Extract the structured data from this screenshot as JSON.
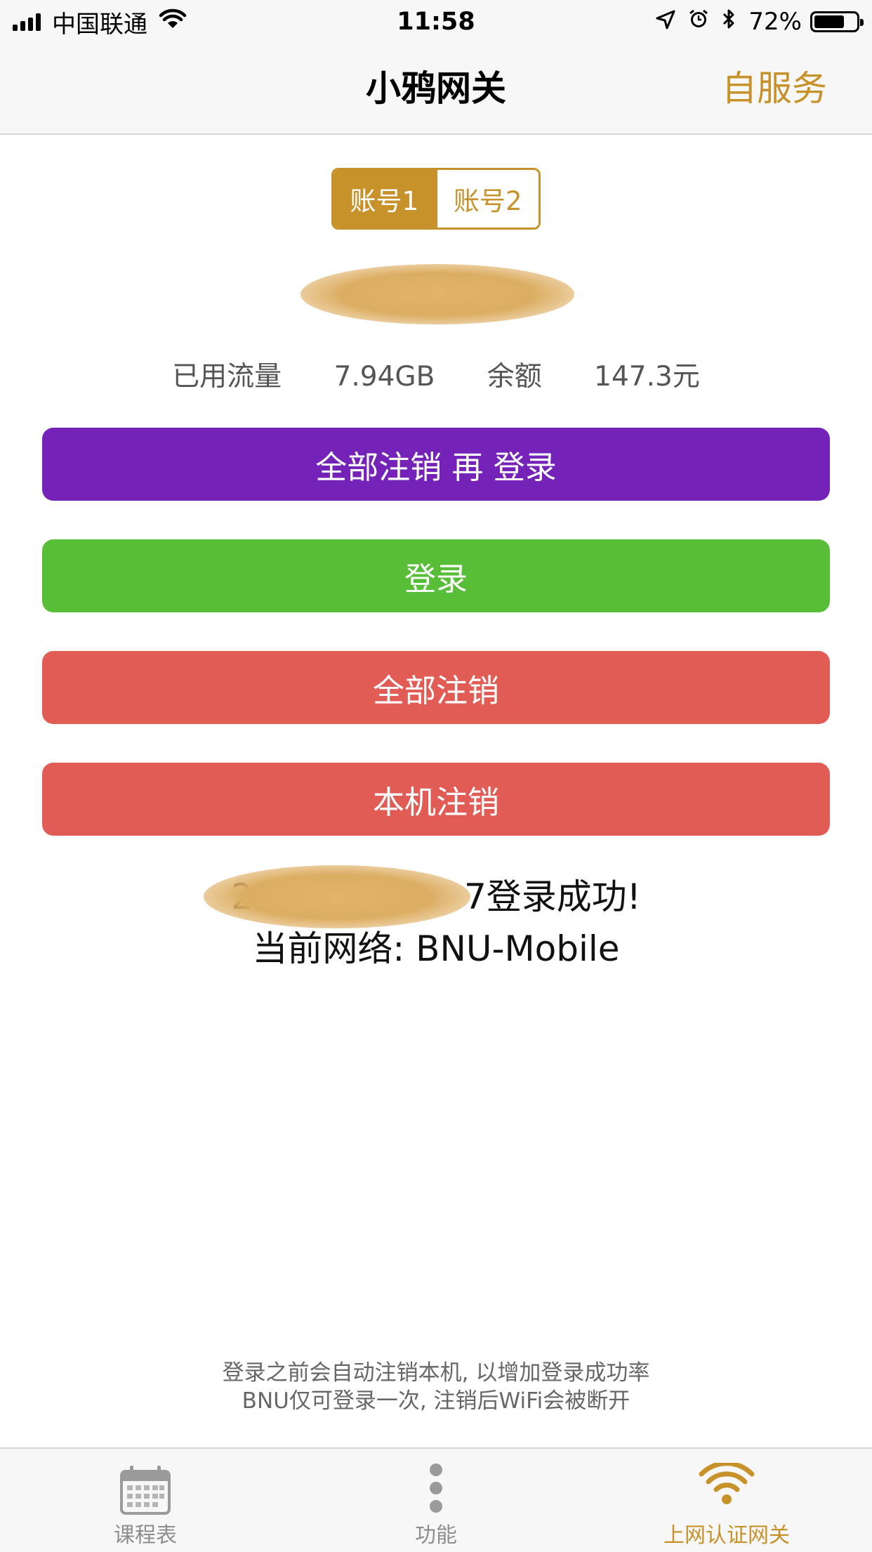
{
  "status_bar": {
    "carrier": "中国联通",
    "time": "11:58",
    "battery_percent": "72%",
    "battery_level": 0.72
  },
  "nav": {
    "title": "小鸦网关",
    "action": "自服务"
  },
  "accounts": {
    "tabs": [
      "账号1",
      "账号2"
    ],
    "selected": "账号1"
  },
  "usage": {
    "used_label": "已用流量",
    "used_value": "7.94GB",
    "balance_label": "余额",
    "balance_value": "147.3元"
  },
  "buttons": {
    "logout_all_relogin": "全部注销 再 登录",
    "login": "登录",
    "logout_all": "全部注销",
    "logout_local": "本机注销"
  },
  "result": {
    "id_prefix": "2",
    "id_suffix": "7",
    "success_text": "登录成功!",
    "network_line": "当前网络: BNU-Mobile"
  },
  "tips": {
    "line1": "登录之前会自动注销本机, 以增加登录成功率",
    "line2": "BNU仅可登录一次, 注销后WiFi会被断开"
  },
  "tabbar": {
    "items": [
      {
        "label": "课程表",
        "icon": "calendar-icon"
      },
      {
        "label": "功能",
        "icon": "more-vertical-icon"
      },
      {
        "label": "上网认证网关",
        "icon": "wifi-icon"
      }
    ],
    "active_index": 2
  },
  "colors": {
    "accent": "#c8922a",
    "purple": "#7522b8",
    "green": "#58bd37",
    "red": "#e05c55"
  }
}
